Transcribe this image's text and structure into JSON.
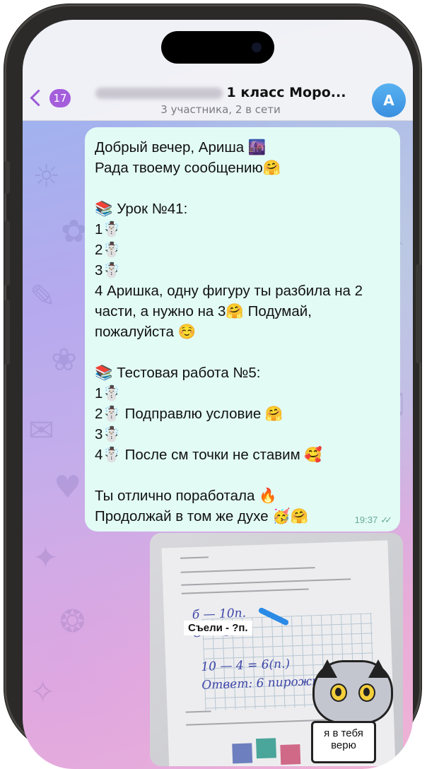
{
  "header": {
    "back_count": "17",
    "title": "1 класс Моро...",
    "subtitle": "3 участника, 2 в сети",
    "avatar_letter": "A"
  },
  "message": {
    "lines": [
      "Добрый вечер, Ариша 🌆",
      "Рада твоему сообщению🤗",
      "",
      "📚 Урок №41:",
      "1☃️",
      "2☃️",
      "3☃️",
      "4 Аришка, одну фигуру ты разбила на 2",
      "части, а нужно на 3🤗 Подумай,",
      "пожалуйста ☺️",
      "",
      "📚 Тестовая работа №5:",
      "1☃️",
      "2☃️ Подправлю условие 🤗",
      "3☃️",
      "4☃️ После см точки не ставим 🥰",
      "",
      "Ты отлично поработала 🔥",
      "Продолжай в том же духе 🥳🤗"
    ],
    "time": "19:37"
  },
  "photo": {
    "caption": "Съели - ?п.",
    "sticker_text": "я в тебя верю"
  },
  "colors": {
    "accent": "#a45ddb",
    "bubble": "#e2fbf5",
    "avatar": "#3a8fe0"
  }
}
